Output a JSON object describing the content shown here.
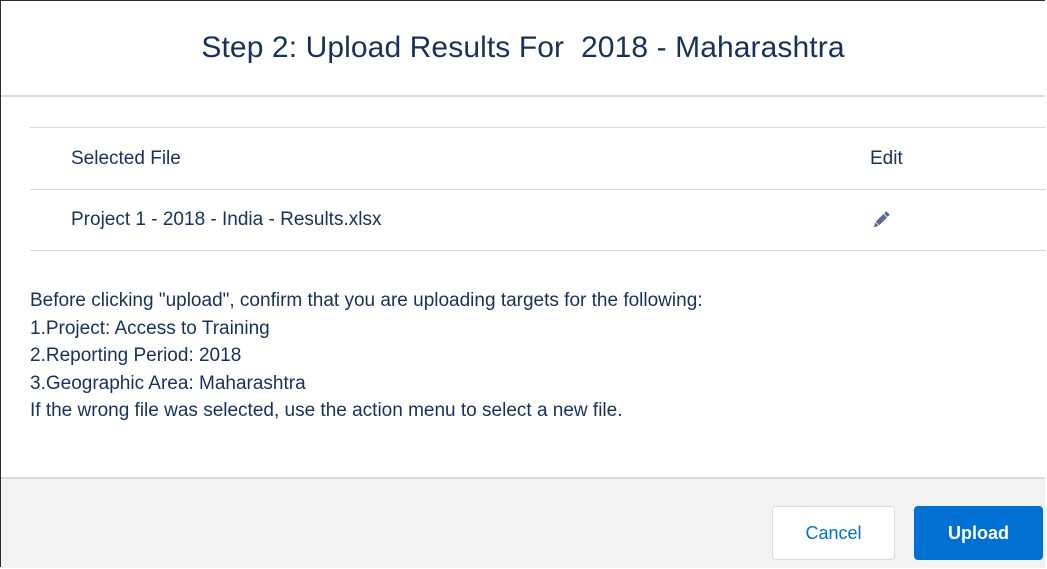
{
  "modal": {
    "title": "Step 2: Upload Results For  2018 - Maharashtra"
  },
  "table": {
    "headers": {
      "file": "Selected File",
      "edit": "Edit"
    },
    "rows": [
      {
        "file": "Project 1 - 2018 - India - Results.xlsx",
        "edit_icon": "pencil-icon"
      }
    ]
  },
  "instructions": {
    "lines": [
      "Before clicking \"upload\", confirm that you are uploading targets for the following:",
      "1.Project: Access to Training",
      "2.Reporting Period: 2018",
      "3.Geographic Area: Maharashtra",
      "If the wrong file was selected, use the action menu to select a new file."
    ]
  },
  "footer": {
    "cancel_label": "Cancel",
    "upload_label": "Upload"
  },
  "colors": {
    "brand": "#0070d2",
    "text": "#16325c",
    "border": "#dddbda",
    "footer_bg": "#f3f2f2"
  }
}
